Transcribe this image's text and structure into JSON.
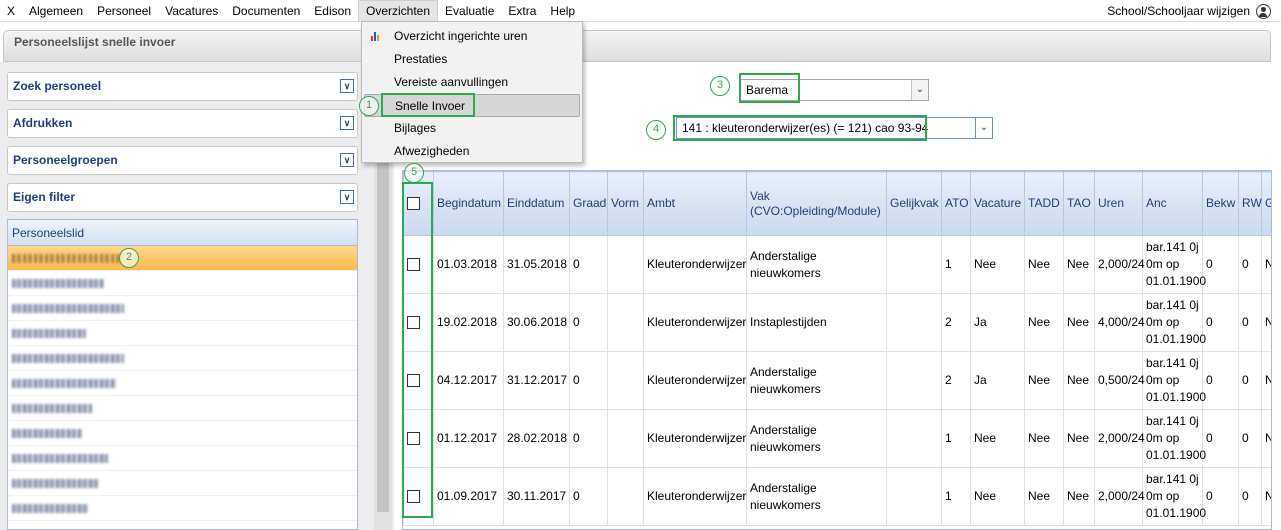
{
  "menubar": {
    "items": [
      "X",
      "Algemeen",
      "Personeel",
      "Vacatures",
      "Documenten",
      "Edison",
      "Overzichten",
      "Evaluatie",
      "Extra",
      "Help"
    ],
    "right_label": "School/Schooljaar wijzigen"
  },
  "panel_title": "Personeelslijst snelle invoer",
  "sidebar": {
    "sections": [
      "Zoek personeel",
      "Afdrukken",
      "Personeelgroepen",
      "Eigen filter"
    ],
    "list_header": "Personeelslid"
  },
  "dropdown": {
    "items": [
      "Overzicht ingerichte uren",
      "Prestaties",
      "Vereiste aanvullingen",
      "Snelle Invoer",
      "Bijlages",
      "Afwezigheden"
    ]
  },
  "barema_select": {
    "value": "Barema"
  },
  "ambt_select": {
    "value": "141 : kleuteronderwijzer(es) (= 121) cao 93-94"
  },
  "annotations": [
    "1",
    "2",
    "3",
    "4",
    "5"
  ],
  "table": {
    "headers": [
      "",
      "Begindatum",
      "Einddatum",
      "Graad",
      "Vorm",
      "Ambt",
      "Vak (CVO:Opleiding/Module)",
      "Gelijkvak",
      "ATO",
      "Vacature",
      "TADD",
      "TAO",
      "Uren",
      "Anc",
      "Bekw",
      "RW",
      "Ge Ka ho"
    ],
    "rows": [
      [
        "",
        "01.03.2018",
        "31.05.2018",
        "0",
        "",
        "Kleuteronderwijzer",
        "Anderstalige nieuwkomers",
        "",
        "1",
        "Nee",
        "Nee",
        "Nee",
        "2,000/24",
        "bar.141 0j 0m op 01.01.1900",
        "0",
        "0",
        "N"
      ],
      [
        "",
        "19.02.2018",
        "30.06.2018",
        "0",
        "",
        "Kleuteronderwijzer",
        "Instaplestijden",
        "",
        "2",
        "Ja",
        "Nee",
        "Nee",
        "4,000/24",
        "bar.141 0j 0m op 01.01.1900",
        "0",
        "0",
        "N"
      ],
      [
        "",
        "04.12.2017",
        "31.12.2017",
        "0",
        "",
        "Kleuteronderwijzer",
        "Anderstalige nieuwkomers",
        "",
        "2",
        "Ja",
        "Nee",
        "Nee",
        "0,500/24",
        "bar.141 0j 0m op 01.01.1900",
        "0",
        "0",
        "N"
      ],
      [
        "",
        "01.12.2017",
        "28.02.2018",
        "0",
        "",
        "Kleuteronderwijzer",
        "Anderstalige nieuwkomers",
        "",
        "1",
        "Nee",
        "Nee",
        "Nee",
        "2,000/24",
        "bar.141 0j 0m op 01.01.1900",
        "0",
        "0",
        "N"
      ],
      [
        "",
        "01.09.2017",
        "30.11.2017",
        "0",
        "",
        "Kleuteronderwijzer",
        "Anderstalige nieuwkomers",
        "",
        "1",
        "Nee",
        "Nee",
        "Nee",
        "2,000/24",
        "bar.141 0j 0m op 01.01.1900",
        "0",
        "0",
        "N"
      ]
    ]
  },
  "colors": {
    "accent_green": "#2fa84f",
    "header_blue": "#1f3d7a",
    "selected_row": "#ffb74a"
  }
}
